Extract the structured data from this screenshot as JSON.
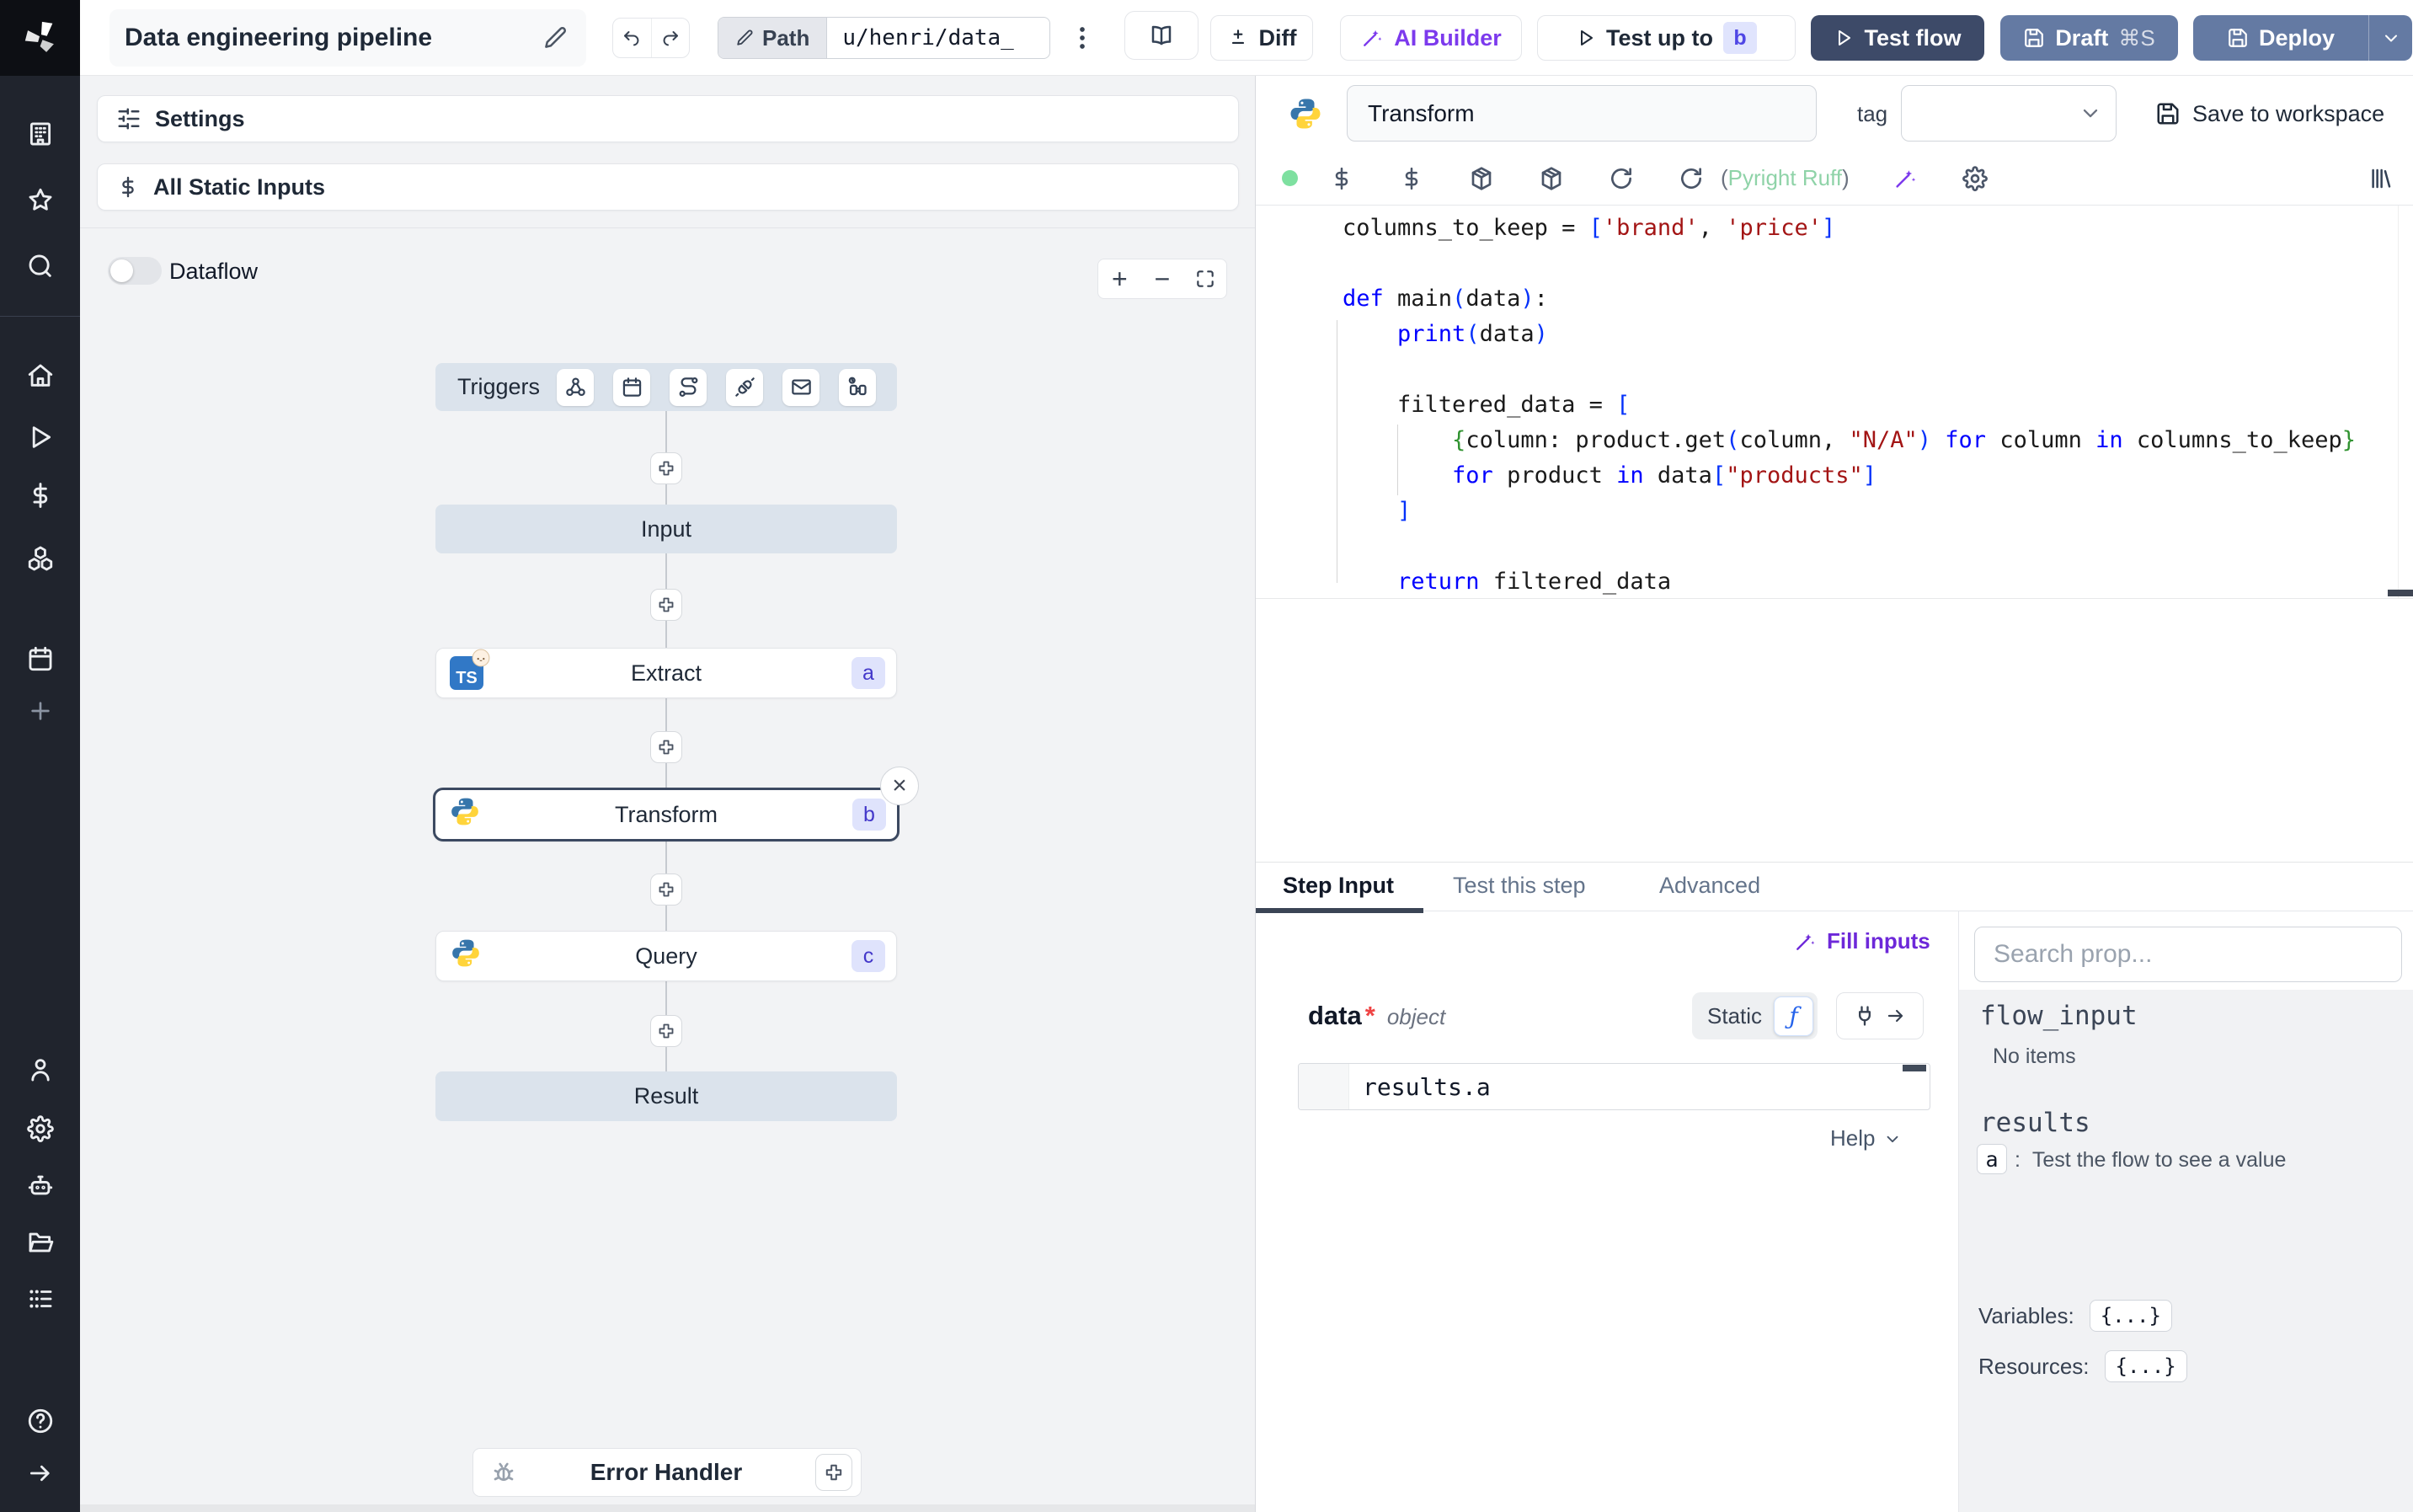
{
  "topbar": {
    "title": "Data engineering pipeline",
    "path_label": "Path",
    "path_value": "u/henri/data_",
    "diff": "Diff",
    "ai_builder": "AI Builder",
    "test_up_to": "Test up to",
    "test_up_to_badge": "b",
    "test_flow": "Test flow",
    "draft": "Draft",
    "draft_shortcut": "⌘S",
    "deploy": "Deploy"
  },
  "flow": {
    "settings": "Settings",
    "all_static_inputs": "All Static Inputs",
    "dataflow": "Dataflow",
    "triggers_label": "Triggers",
    "input_label": "Input",
    "result_label": "Result",
    "error_handler": "Error Handler",
    "steps": {
      "extract": {
        "label": "Extract",
        "badge": "a"
      },
      "transform": {
        "label": "Transform",
        "badge": "b"
      },
      "query": {
        "label": "Query",
        "badge": "c"
      }
    }
  },
  "editor": {
    "step_name": "Transform",
    "tag_label": "tag",
    "save_to_workspace": "Save to workspace",
    "assistants": "(Pyright Ruff)",
    "assistant_color": "#8fd3a8",
    "status_dot_color": "#7ee0a0",
    "code": {
      "colors": {
        "d": "#1a1a1a",
        "k": "#0000ff",
        "s": "#a31515",
        "bB": "#0431fa",
        "bG": "#319331"
      },
      "lines": [
        [
          {
            "t": "columns_to_keep = ",
            "c": "d"
          },
          {
            "t": "[",
            "c": "bB"
          },
          {
            "t": "'brand'",
            "c": "s"
          },
          {
            "t": ", ",
            "c": "d"
          },
          {
            "t": "'price'",
            "c": "s"
          },
          {
            "t": "]",
            "c": "bB"
          }
        ],
        [],
        [
          {
            "t": "def ",
            "c": "k"
          },
          {
            "t": "main",
            "c": "d"
          },
          {
            "t": "(",
            "c": "bB"
          },
          {
            "t": "data",
            "c": "d"
          },
          {
            "t": ")",
            "c": "bB"
          },
          {
            "t": ":",
            "c": "d"
          }
        ],
        [
          {
            "t": "    ",
            "c": "d"
          },
          {
            "t": "print",
            "c": "k"
          },
          {
            "t": "(",
            "c": "bB"
          },
          {
            "t": "data",
            "c": "d"
          },
          {
            "t": ")",
            "c": "bB"
          }
        ],
        [],
        [
          {
            "t": "    filtered_data = ",
            "c": "d"
          },
          {
            "t": "[",
            "c": "bB"
          }
        ],
        [
          {
            "t": "        ",
            "c": "d"
          },
          {
            "t": "{",
            "c": "bG"
          },
          {
            "t": "column: product.get",
            "c": "d"
          },
          {
            "t": "(",
            "c": "bB"
          },
          {
            "t": "column, ",
            "c": "d"
          },
          {
            "t": "\"N/A\"",
            "c": "s"
          },
          {
            "t": ")",
            "c": "bB"
          },
          {
            "t": " ",
            "c": "d"
          },
          {
            "t": "for",
            "c": "k"
          },
          {
            "t": " column ",
            "c": "d"
          },
          {
            "t": "in",
            "c": "k"
          },
          {
            "t": " columns_to_keep",
            "c": "d"
          },
          {
            "t": "}",
            "c": "bG"
          }
        ],
        [
          {
            "t": "        ",
            "c": "d"
          },
          {
            "t": "for",
            "c": "k"
          },
          {
            "t": " product ",
            "c": "d"
          },
          {
            "t": "in",
            "c": "k"
          },
          {
            "t": " data",
            "c": "d"
          },
          {
            "t": "[",
            "c": "bB"
          },
          {
            "t": "\"products\"",
            "c": "s"
          },
          {
            "t": "]",
            "c": "bB"
          }
        ],
        [
          {
            "t": "    ",
            "c": "d"
          },
          {
            "t": "]",
            "c": "bB"
          }
        ],
        [],
        [
          {
            "t": "    ",
            "c": "d"
          },
          {
            "t": "return",
            "c": "k"
          },
          {
            "t": " filtered_data",
            "c": "d"
          }
        ]
      ]
    }
  },
  "step_panel": {
    "tabs": [
      "Step Input",
      "Test this step",
      "Advanced"
    ],
    "fill_inputs": "Fill inputs",
    "arg": {
      "name": "data",
      "required": "*",
      "type": "object"
    },
    "static_label": "Static",
    "expression": "results.a",
    "help": "Help"
  },
  "props": {
    "search_placeholder": "Search prop...",
    "flow_input_title": "flow_input",
    "flow_input_empty": "No items",
    "results_title": "results",
    "result_items": [
      {
        "key": "a",
        "hint": "Test the flow to see a value"
      }
    ],
    "variables_label": "Variables:",
    "variables_value": "{...}",
    "resources_label": "Resources:",
    "resources_value": "{...}"
  }
}
